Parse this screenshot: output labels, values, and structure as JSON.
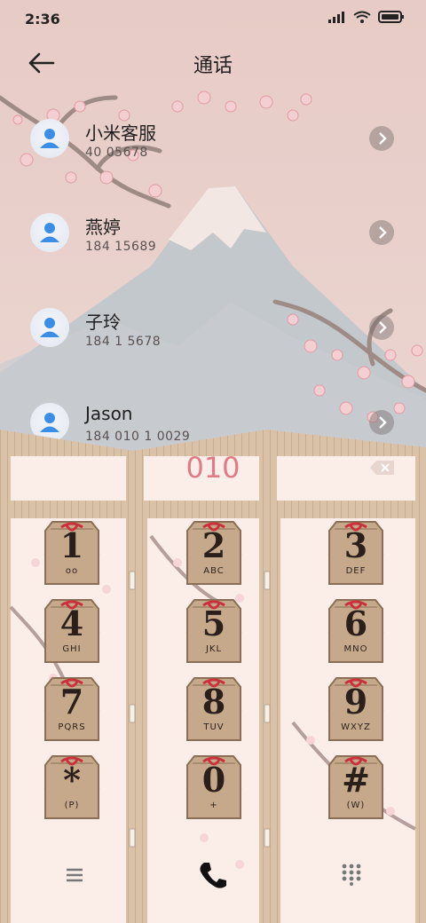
{
  "status_bar": {
    "time": "2:36"
  },
  "header": {
    "title": "通话"
  },
  "contacts": [
    {
      "name": "小米客服",
      "number": "40    05678"
    },
    {
      "name": "燕婷",
      "number": "184      15689"
    },
    {
      "name": "子玲",
      "number": "184      1 5678"
    },
    {
      "name": "Jason",
      "number": "184 010 1 0029"
    }
  ],
  "dialer": {
    "input": "010",
    "keys": [
      {
        "digit": "1",
        "letters": "oo"
      },
      {
        "digit": "2",
        "letters": "ABC"
      },
      {
        "digit": "3",
        "letters": "DEF"
      },
      {
        "digit": "4",
        "letters": "GHI"
      },
      {
        "digit": "5",
        "letters": "JKL"
      },
      {
        "digit": "6",
        "letters": "MNO"
      },
      {
        "digit": "7",
        "letters": "PQRS"
      },
      {
        "digit": "8",
        "letters": "TUV"
      },
      {
        "digit": "9",
        "letters": "WXYZ"
      },
      {
        "digit": "*",
        "letters": "(P)"
      },
      {
        "digit": "0",
        "letters": "+"
      },
      {
        "digit": "#",
        "letters": "(W)"
      }
    ]
  },
  "icons": {
    "back": "arrow-left-icon",
    "chevron": "chevron-right-icon",
    "delete": "backspace-icon",
    "menu": "menu-icon",
    "call": "phone-icon",
    "dialpad": "dialpad-icon"
  },
  "colors": {
    "accent": "#e07a87",
    "wood": "#d9c2a8",
    "rope": "#c8323a"
  }
}
